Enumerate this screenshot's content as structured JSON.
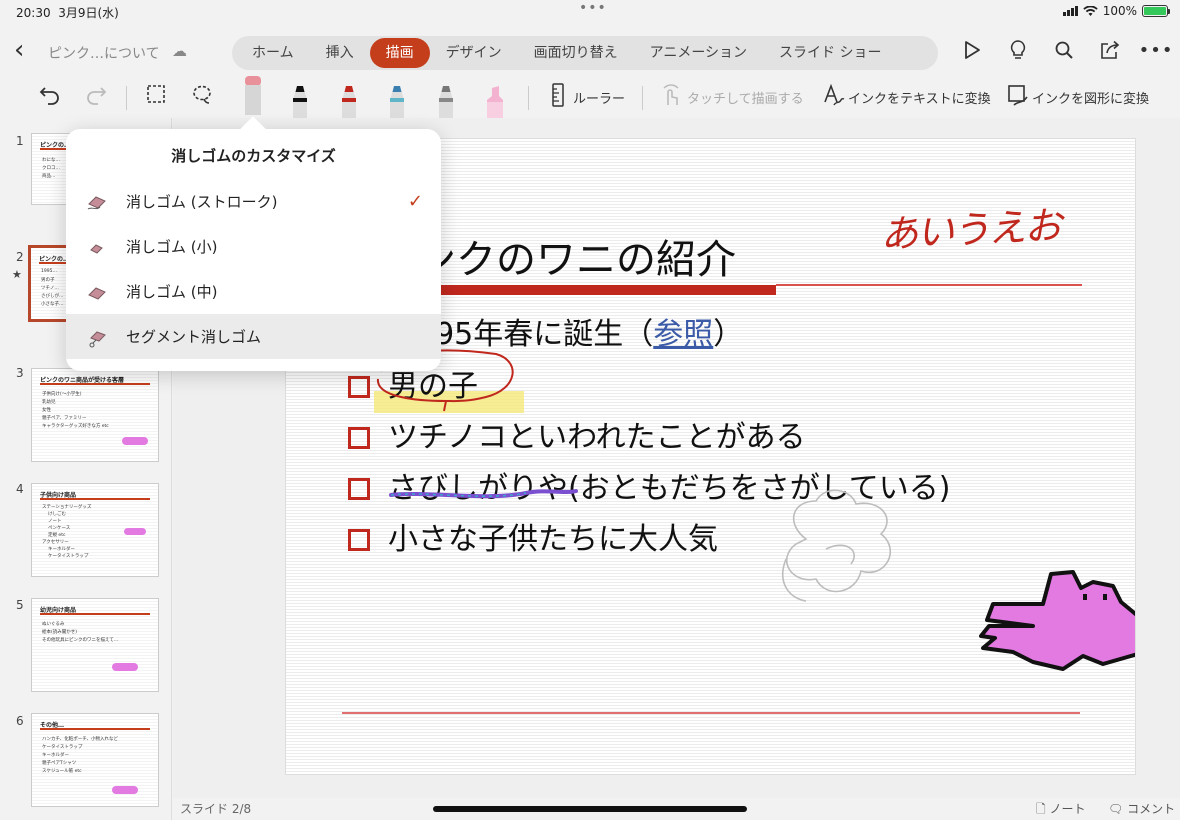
{
  "status": {
    "time": "20:30",
    "date": "3月9日(水)",
    "battery": "100%",
    "battery_level": 1.0
  },
  "app": {
    "doc_title": "ピンク…について"
  },
  "tabs": [
    "ホーム",
    "挿入",
    "描画",
    "デザイン",
    "画面切り替え",
    "アニメーション",
    "スライド ショー"
  ],
  "active_tab": "描画",
  "draw_toolbar": {
    "ruler": "ルーラー",
    "touch_draw": "タッチして描画する",
    "ink_to_text": "インクをテキストに変換",
    "ink_to_shape": "インクを図形に変換"
  },
  "popover": {
    "title": "消しゴムのカスタマイズ",
    "items": [
      {
        "label": "消しゴム (ストローク)",
        "checked": true
      },
      {
        "label": "消しゴム (小)"
      },
      {
        "label": "消しゴム (中)"
      },
      {
        "label": "セグメント消しゴム"
      }
    ]
  },
  "thumbnails": [
    {
      "num": "1",
      "title": "ピンクの…",
      "lines": [
        "わにな…",
        "クロコ…",
        "商品…"
      ]
    },
    {
      "num": "2",
      "title": "ピンクの…",
      "lines": [
        "1995…",
        "男の子",
        "ツチノ…",
        "さびしが…",
        "小さな子…"
      ]
    },
    {
      "num": "3",
      "title": "ピンクのワニ商品が受ける客層",
      "lines": [
        "子供向け(～小学生)",
        "乳幼児",
        "女性",
        "親子ペア、ファミリー",
        "キャラクターグッズ好きな方 etc"
      ]
    },
    {
      "num": "4",
      "title": "子供向け商品",
      "lines": [
        "ステーショナリーグッズ",
        "けしごむ",
        "ノート",
        "ペンケース",
        "定規 etc",
        "アクセサリー",
        "キーホルダー",
        "ケータイストラップ"
      ]
    },
    {
      "num": "5",
      "title": "幼児向け商品",
      "lines": [
        "ぬいぐるみ",
        "絵本(読み聞かせ)",
        "その他玩具にピンクのワニを描えて…"
      ]
    },
    {
      "num": "6",
      "title": "その他…",
      "lines": [
        "ハンカチ、化粧ポーチ、小物入れなど",
        "ケータイストラップ",
        "キーホルダー",
        "親子ペアTシャツ",
        "スケジュール帳 etc"
      ]
    }
  ],
  "slide": {
    "title": "ンクのワニの紹介",
    "bullet1_pre": "995年春に誕生（",
    "bullet1_link": "参照",
    "bullet1_post": "）",
    "bullets": [
      "男の子",
      "ツチノコといわれたことがある",
      "さびしがりや(おともだちをさがしている)",
      "小さな子供たちに大人気"
    ],
    "handwriting": "あいうえお"
  },
  "footer": {
    "slide_count": "スライド 2/8",
    "notes": "ノート",
    "comments": "コメント"
  },
  "colors": {
    "accent": "#c43e1c",
    "slide_red": "#c0281e",
    "ink_pink": "#e27ae2"
  }
}
